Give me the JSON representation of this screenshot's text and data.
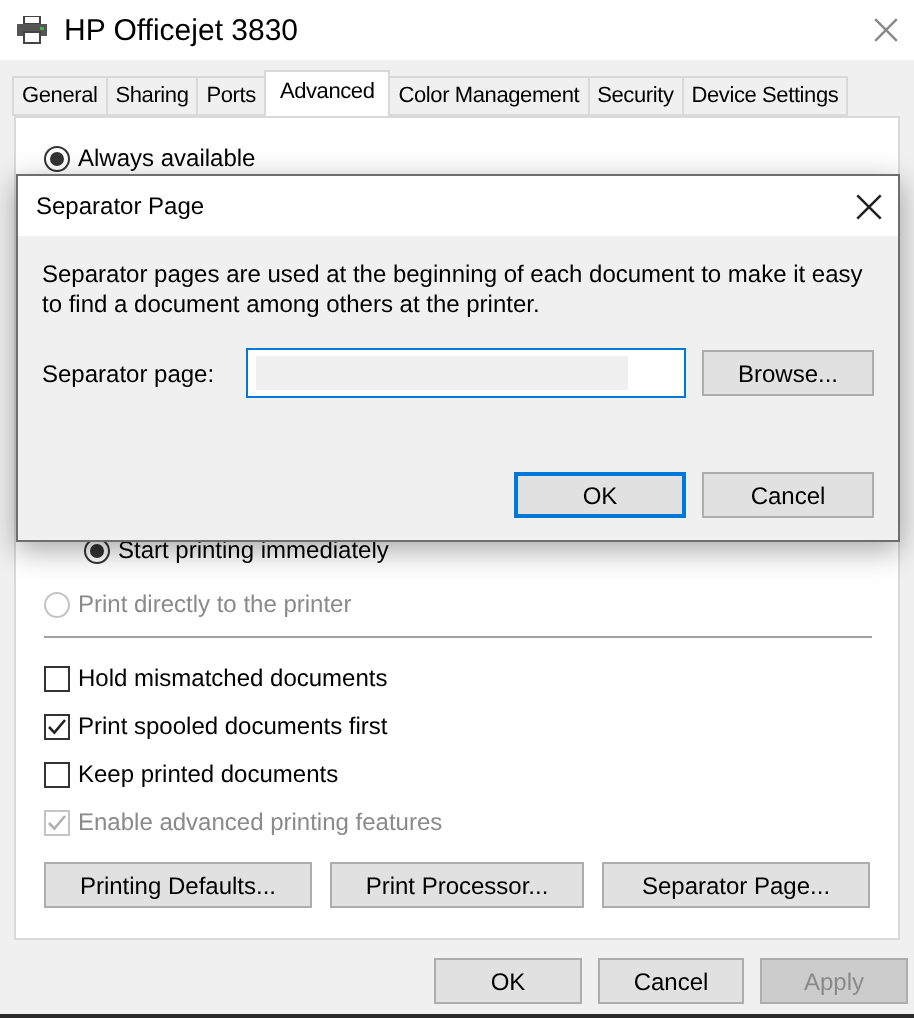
{
  "window": {
    "title": "HP Officejet 3830"
  },
  "tabs": [
    {
      "label": "General",
      "selected": false
    },
    {
      "label": "Sharing",
      "selected": false
    },
    {
      "label": "Ports",
      "selected": false
    },
    {
      "label": "Advanced",
      "selected": true
    },
    {
      "label": "Color Management",
      "selected": false
    },
    {
      "label": "Security",
      "selected": false
    },
    {
      "label": "Device Settings",
      "selected": false
    }
  ],
  "panel": {
    "availability": {
      "label": "Always available",
      "selected": true
    },
    "start_option": {
      "label": "Start printing immediately",
      "selected": true
    },
    "direct_option": {
      "label": "Print directly to the printer",
      "selected": false,
      "disabled": true
    },
    "checkboxes": [
      {
        "label": "Hold mismatched documents",
        "checked": false,
        "disabled": false
      },
      {
        "label": "Print spooled documents first",
        "checked": true,
        "disabled": false
      },
      {
        "label": "Keep printed documents",
        "checked": false,
        "disabled": false
      },
      {
        "label": "Enable advanced printing features",
        "checked": true,
        "disabled": true
      }
    ],
    "buttons": [
      "Printing Defaults...",
      "Print Processor...",
      "Separator Page..."
    ]
  },
  "dialog": {
    "title": "Separator Page",
    "description": "Separator pages are used at the beginning of each document to make it easy to find a document among others at the printer.",
    "field_label": "Separator page:",
    "browse_button": "Browse...",
    "buttons": [
      {
        "label": "OK",
        "default": true
      },
      {
        "label": "Cancel",
        "default": false
      }
    ]
  },
  "buttons": [
    {
      "label": "OK",
      "disabled": false
    },
    {
      "label": "Cancel",
      "disabled": false
    },
    {
      "label": "Apply",
      "disabled": true
    }
  ]
}
